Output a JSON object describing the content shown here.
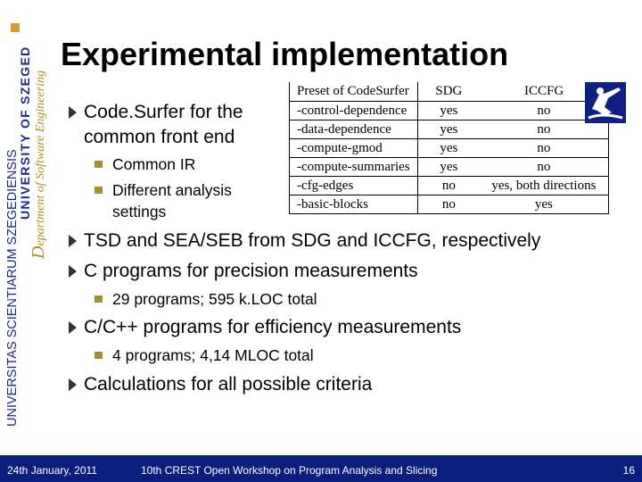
{
  "sidebar": {
    "latin": "UNIVERSITAS SCIENTIARUM SZEGEDIENSIS",
    "university": "UNIVERSITY OF SZEGED",
    "dept_initial": "D",
    "dept_rest": "epartment of Software Engineering"
  },
  "title": "Experimental implementation",
  "bullets": [
    {
      "text": "Code.Surfer for the common front end",
      "subs": [
        "Common IR",
        "Different analysis settings"
      ]
    },
    {
      "text": "TSD and SEA/SEB from SDG and ICCFG, respectively"
    },
    {
      "text": "C programs for precision measurements",
      "subs": [
        "29 programs; 595 k.LOC total"
      ]
    },
    {
      "text": "C/C++ programs for efficiency measurements",
      "subs": [
        "4 programs; 4,14 MLOC total"
      ]
    },
    {
      "text": "Calculations for all possible criteria"
    }
  ],
  "table": {
    "headers": [
      "Preset of CodeSurfer",
      "SDG",
      "ICCFG"
    ],
    "rows": [
      [
        "-control-dependence",
        "yes",
        "no"
      ],
      [
        "-data-dependence",
        "yes",
        "no"
      ],
      [
        "-compute-gmod",
        "yes",
        "no"
      ],
      [
        "-compute-summaries",
        "yes",
        "no"
      ],
      [
        "-cfg-edges",
        "no",
        "yes, both directions"
      ],
      [
        "-basic-blocks",
        "no",
        "yes"
      ]
    ]
  },
  "footer": {
    "date": "24th January, 2011",
    "event": "10th CREST Open Workshop on Program Analysis and Slicing",
    "page": "16"
  },
  "colors": {
    "footer_bg": "#0a1e7e",
    "accent": "#d0a030"
  }
}
